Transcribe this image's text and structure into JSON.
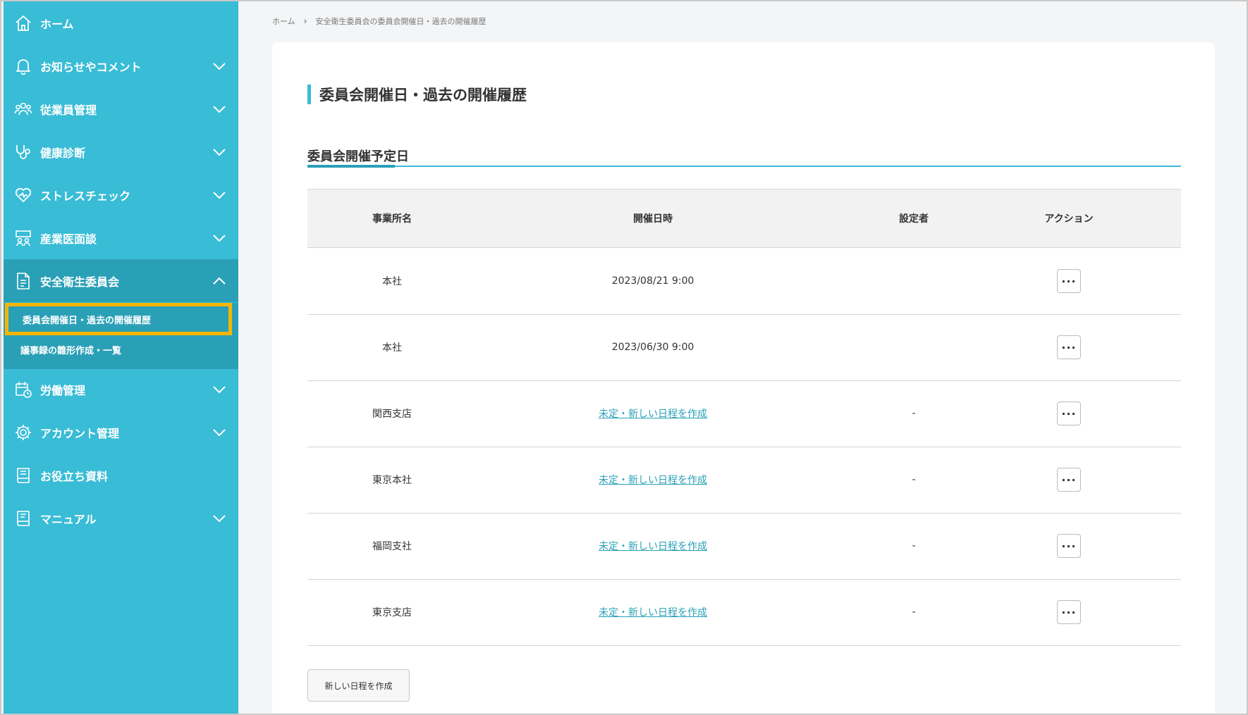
{
  "sidebar": {
    "items": [
      {
        "label": "ホーム",
        "icon": "home-icon",
        "has_chevron": false
      },
      {
        "label": "お知らせやコメント",
        "icon": "bell-icon",
        "has_chevron": true
      },
      {
        "label": "従業員管理",
        "icon": "users-icon",
        "has_chevron": true
      },
      {
        "label": "健康診断",
        "icon": "stethoscope-icon",
        "has_chevron": true
      },
      {
        "label": "ストレスチェック",
        "icon": "heart-icon",
        "has_chevron": true
      },
      {
        "label": "産業医面談",
        "icon": "meeting-icon",
        "has_chevron": true
      },
      {
        "label": "安全衛生委員会",
        "icon": "document-icon",
        "has_chevron": true,
        "expanded": true
      },
      {
        "label": "労働管理",
        "icon": "calendar-clock-icon",
        "has_chevron": true
      },
      {
        "label": "アカウント管理",
        "icon": "gear-icon",
        "has_chevron": true
      },
      {
        "label": "お役立ち資料",
        "icon": "book-icon",
        "has_chevron": false
      },
      {
        "label": "マニュアル",
        "icon": "manual-icon",
        "has_chevron": true
      }
    ],
    "subitems": [
      {
        "label": "委員会開催日・過去の開催履歴",
        "selected": true
      },
      {
        "label": "議事録の雛形作成・一覧",
        "selected": false
      }
    ],
    "colors": {
      "background": "#39bcd6",
      "active": "#2aa0b7",
      "highlight": "#f7b500"
    }
  },
  "breadcrumb": {
    "home": "ホーム",
    "separator": "›",
    "current": "安全衛生委員会の委員会開催日・過去の開催履歴"
  },
  "page": {
    "title": "委員会開催日・過去の開催履歴",
    "section_title": "委員会開催予定日"
  },
  "table": {
    "headers": [
      "事業所名",
      "開催日時",
      "設定者",
      "アクション"
    ],
    "rows": [
      {
        "office": "本社",
        "datetime": "2023/08/21 9:00",
        "is_link": false,
        "setter": "",
        "action": "···"
      },
      {
        "office": "本社",
        "datetime": "2023/06/30 9:00",
        "is_link": false,
        "setter": "",
        "action": "···"
      },
      {
        "office": "関西支店",
        "datetime": "未定・新しい日程を作成",
        "is_link": true,
        "setter": "-",
        "action": "···"
      },
      {
        "office": "東京本社",
        "datetime": "未定・新しい日程を作成",
        "is_link": true,
        "setter": "-",
        "action": "···"
      },
      {
        "office": "福岡支社",
        "datetime": "未定・新しい日程を作成",
        "is_link": true,
        "setter": "-",
        "action": "···"
      },
      {
        "office": "東京支店",
        "datetime": "未定・新しい日程を作成",
        "is_link": true,
        "setter": "-",
        "action": "···"
      }
    ]
  },
  "buttons": {
    "new_schedule": "新しい日程を作成"
  }
}
